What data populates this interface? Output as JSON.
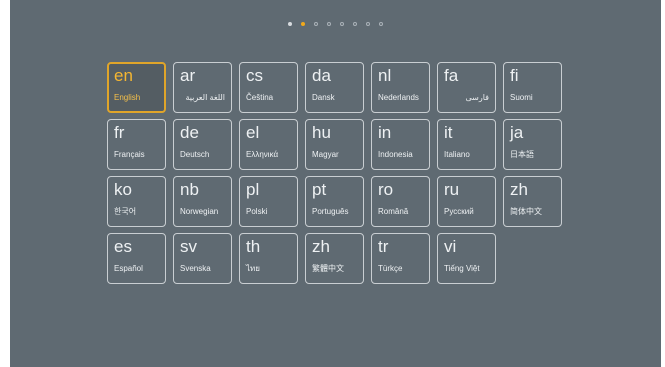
{
  "pager": {
    "total": 8,
    "active_index": 1,
    "colors": {
      "active": "#f0a81c",
      "filled": "#d7dbde",
      "empty": "#aab2b8"
    }
  },
  "accent_color": "#e0a52a",
  "languages": [
    {
      "code": "en",
      "name": "English",
      "selected": true
    },
    {
      "code": "ar",
      "name": "اللغة العربية",
      "rtl": true
    },
    {
      "code": "cs",
      "name": "Čeština"
    },
    {
      "code": "da",
      "name": "Dansk"
    },
    {
      "code": "nl",
      "name": "Nederlands"
    },
    {
      "code": "fa",
      "name": "فارسی",
      "rtl": true
    },
    {
      "code": "fi",
      "name": "Suomi"
    },
    {
      "code": "fr",
      "name": "Français"
    },
    {
      "code": "de",
      "name": "Deutsch"
    },
    {
      "code": "el",
      "name": "Ελληνικά"
    },
    {
      "code": "hu",
      "name": "Magyar"
    },
    {
      "code": "in",
      "name": "Indonesia"
    },
    {
      "code": "it",
      "name": "Italiano"
    },
    {
      "code": "ja",
      "name": "日本語"
    },
    {
      "code": "ko",
      "name": "한국어"
    },
    {
      "code": "nb",
      "name": "Norwegian"
    },
    {
      "code": "pl",
      "name": "Polski"
    },
    {
      "code": "pt",
      "name": "Português"
    },
    {
      "code": "ro",
      "name": "Română"
    },
    {
      "code": "ru",
      "name": "Русский"
    },
    {
      "code": "zh",
      "name": "简体中文"
    },
    {
      "code": "es",
      "name": "Español"
    },
    {
      "code": "sv",
      "name": "Svenska"
    },
    {
      "code": "th",
      "name": "ไทย"
    },
    {
      "code": "zh",
      "name": "繁體中文"
    },
    {
      "code": "tr",
      "name": "Türkçe"
    },
    {
      "code": "vi",
      "name": "Tiếng Việt"
    }
  ]
}
